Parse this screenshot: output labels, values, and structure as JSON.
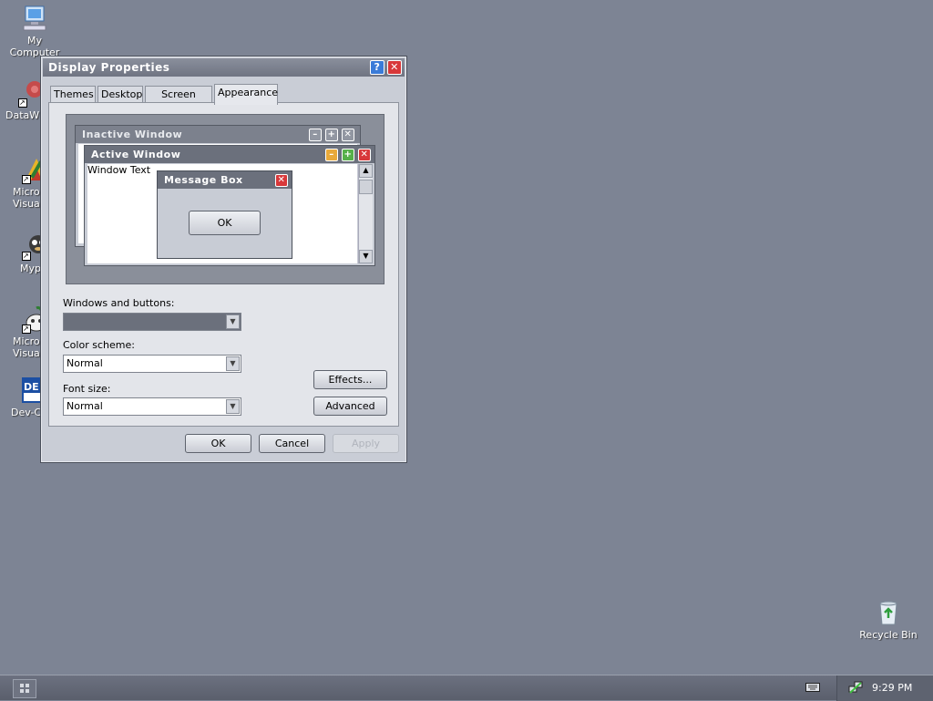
{
  "desktop": {
    "icons": [
      {
        "label_line1": "My",
        "label_line2": "Computer",
        "icon": "computer-icon"
      },
      {
        "label_line1": "DataW",
        "label_line2": "",
        "icon": "app-shortcut-icon"
      },
      {
        "label_line1": "Micro",
        "label_line2": "Visual",
        "icon": "visual-studio-icon"
      },
      {
        "label_line1": "Myp",
        "label_line2": "",
        "icon": "app-shortcut-icon"
      },
      {
        "label_line1": "Micro",
        "label_line2": "Visual",
        "icon": "visual-app-icon"
      },
      {
        "label_line1": "Dev-C",
        "label_line2": "",
        "icon": "dev-cpp-icon"
      }
    ],
    "recycle_bin": "Recycle Bin"
  },
  "window": {
    "title": "Display Properties",
    "tabs": [
      {
        "label": "Themes",
        "active": false
      },
      {
        "label": "Desktop",
        "active": false
      },
      {
        "label": "Screen Saver",
        "active": false
      },
      {
        "label": "Appearance",
        "active": true
      }
    ],
    "preview": {
      "inactive_title": "Inactive Window",
      "active_title": "Active Window",
      "window_text": "Window Text",
      "message_box_title": "Message Box",
      "message_box_ok": "OK"
    },
    "windows_and_buttons_label": "Windows and buttons:",
    "windows_and_buttons_value": "",
    "color_scheme_label": "Color scheme:",
    "color_scheme_value": "Normal",
    "font_size_label": "Font size:",
    "font_size_value": "Normal",
    "effects_button": "Effects...",
    "advanced_button": "Advanced",
    "ok_button": "OK",
    "cancel_button": "Cancel",
    "apply_button": "Apply"
  },
  "taskbar": {
    "clock": "9:29 PM"
  },
  "colors": {
    "desktop": "#7d8494",
    "minimize_active": "#e8a93a",
    "maximize_active": "#56b04a",
    "close": "#d8383a",
    "help": "#3a7bd8"
  }
}
